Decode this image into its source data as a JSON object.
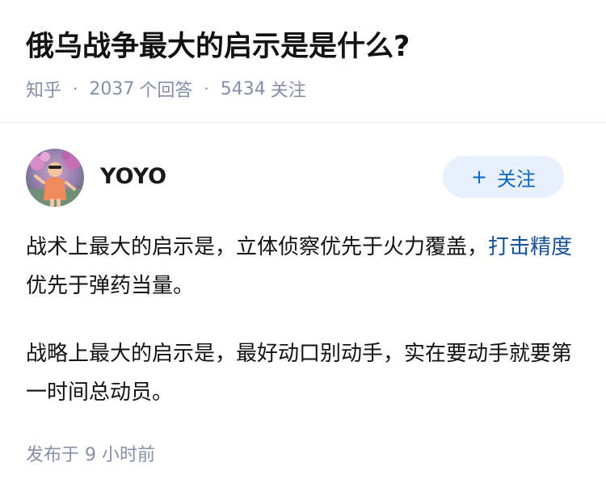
{
  "question": {
    "title": "俄乌战争最大的启示是是什么?",
    "source": "知乎",
    "answer_count": "2037",
    "answer_label": "个回答",
    "follower_count": "5434",
    "follower_label": "关注",
    "separator": "·"
  },
  "answer": {
    "author": {
      "name": "YOYO",
      "avatar_icon": "avatar-photo"
    },
    "follow_button": {
      "plus": "+",
      "label": "关注"
    },
    "paragraph1": {
      "before": "战术上最大的启示是，立体侦察优先于火力覆盖，",
      "link": "打击精度",
      "after": "优先于弹药当量。"
    },
    "paragraph2": "战略上最大的启示是，最好动口别动手，实在要动手就要第一时间总动员。",
    "posted_label": "发布于",
    "posted_time": "9 小时前"
  },
  "colors": {
    "link": "#175199",
    "follow_text": "#0a66c2",
    "follow_bg": "#e8f1fb",
    "meta_gray": "#8590a6"
  }
}
